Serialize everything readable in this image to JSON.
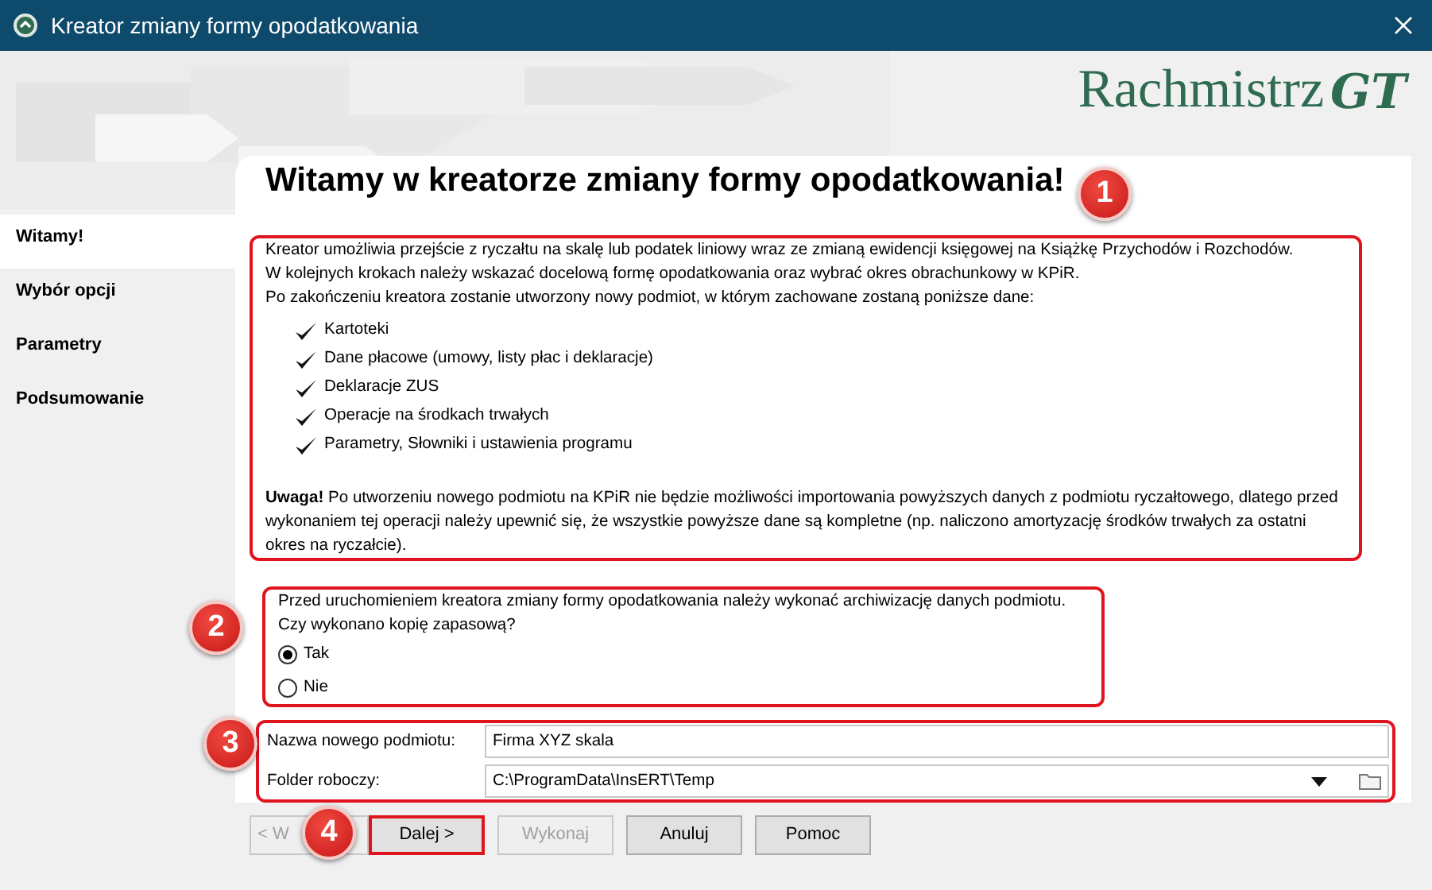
{
  "window": {
    "title": "Kreator zmiany formy opodatkowania"
  },
  "logo": {
    "text": "Rachmistrz",
    "mark": "GT"
  },
  "sidebar": {
    "items": [
      {
        "label": "Witamy!",
        "selected": true
      },
      {
        "label": "Wybór opcji",
        "selected": false
      },
      {
        "label": "Parametry",
        "selected": false
      },
      {
        "label": "Podsumowanie",
        "selected": false
      }
    ]
  },
  "heading": "Witamy w kreatorze zmiany formy opodatkowania!",
  "intro": {
    "highlighted": true,
    "badge": "1",
    "lines": [
      "Kreator umożliwia przejście z ryczałtu na skalę lub podatek liniowy wraz ze zmianą ewidencji księgowej na Książkę Przychodów i Rozchodów.",
      "W kolejnych krokach należy wskazać docelową formę opodatkowania oraz wybrać okres obrachunkowy w KPiR.",
      "Po zakończeniu kreatora zostanie utworzony nowy podmiot, w którym zachowane zostaną poniższe dane:"
    ],
    "checklist": [
      "Kartoteki",
      "Dane płacowe (umowy, listy płac i deklaracje)",
      "Deklaracje ZUS",
      "Operacje na środkach trwałych",
      "Parametry, Słowniki i ustawienia programu"
    ],
    "warning": "**Uwaga!** Po utworzeniu nowego podmiotu na KPiR nie będzie możliwości importowania powyższych danych z podmiotu ryczałtowego, dlatego przed wykonaniem tej operacji należy upewnić się, że wszystkie powyższe dane są kompletne (np. naliczono amortyzację środków trwałych za ostatni okres na ryczałcie)."
  },
  "backup": {
    "highlighted": true,
    "badge": "2",
    "question_lines": [
      "Przed uruchomieniem kreatora zmiany formy opodatkowania należy wykonać archiwizację danych podmiotu.",
      "Czy wykonano kopię zapasową?"
    ],
    "options": [
      {
        "label": "Tak",
        "selected": true
      },
      {
        "label": "Nie",
        "selected": false
      }
    ]
  },
  "fields": {
    "highlighted": true,
    "badge": "3",
    "rows": [
      {
        "kind": "text",
        "label": "Nazwa nowego podmiotu:",
        "value": "Firma XYZ skala"
      },
      {
        "kind": "combo",
        "label": "Folder roboczy:",
        "value": "C:\\ProgramData\\InsERT\\Temp"
      }
    ]
  },
  "buttons": [
    {
      "label": "< W",
      "disabled": true,
      "highlighted": false
    },
    {
      "label": "Dalej >",
      "disabled": false,
      "highlighted": true
    },
    {
      "label": "Wykonaj",
      "disabled": true,
      "highlighted": false
    },
    {
      "label": "Anuluj",
      "disabled": false,
      "highlighted": false
    },
    {
      "label": "Pomoc",
      "disabled": false,
      "highlighted": false
    }
  ],
  "buttons_badge": "4"
}
